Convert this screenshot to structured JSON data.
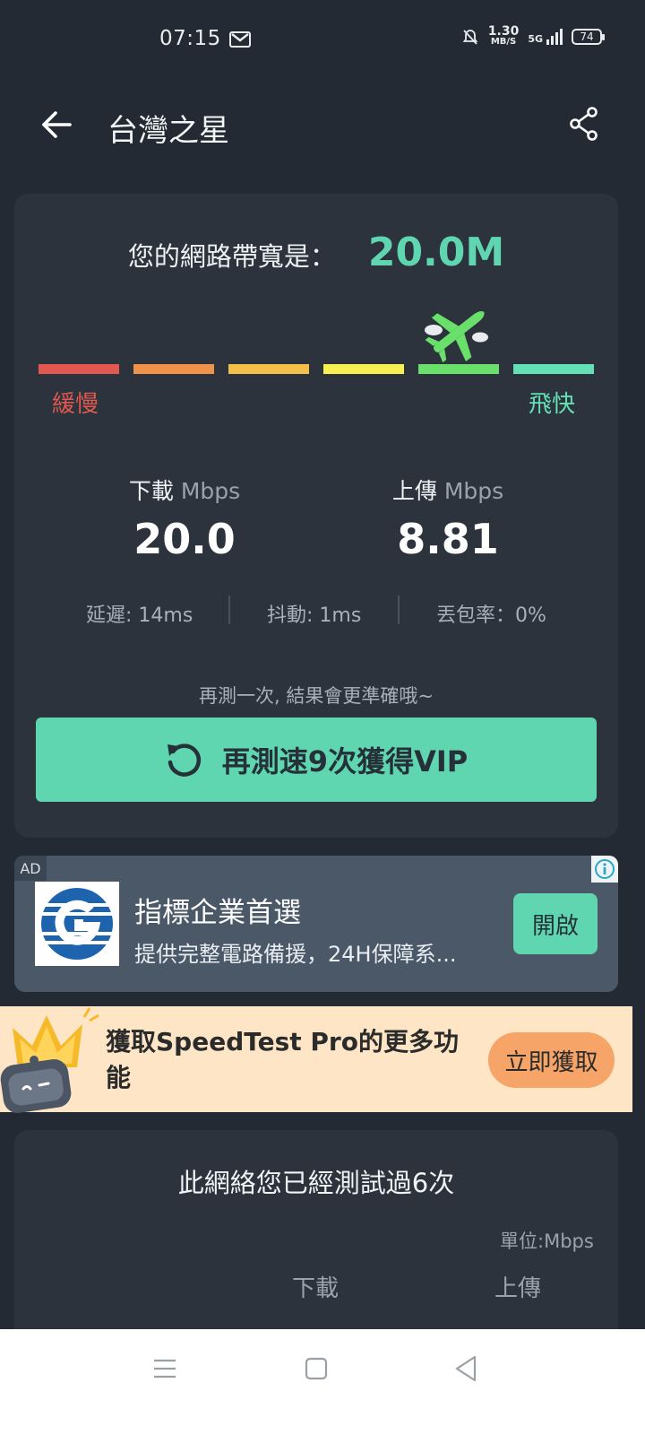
{
  "status_bar": {
    "time": "07:15",
    "net_speed_value": "1.30",
    "net_speed_unit": "MB/S",
    "network_type": "5G",
    "battery": "74",
    "icons": [
      "gmail-icon",
      "mute-bell-icon",
      "signal-icon",
      "battery-icon"
    ]
  },
  "header": {
    "title": "台灣之星",
    "back_icon": "arrow-left-icon",
    "share_icon": "share-icon"
  },
  "result": {
    "bandwidth_label": "您的網路帶寬是：",
    "bandwidth_value": "20.0M",
    "speed_scale": {
      "segment_colors": [
        "#e0584f",
        "#f0924a",
        "#f4c04a",
        "#f7f050",
        "#69e06a",
        "#63e0b4"
      ],
      "active_level": 5,
      "slow_label": "緩慢",
      "fast_label": "飛快",
      "indicator_icon": "airplane-icon"
    },
    "download": {
      "name": "下載",
      "unit": "Mbps",
      "value": "20.0"
    },
    "upload": {
      "name": "上傳",
      "unit": "Mbps",
      "value": "8.81"
    },
    "latency": "延遲: 14ms",
    "jitter": "抖動: 1ms",
    "packet_loss": "丟包率：0%",
    "hint": "再測一次, 結果會更準確哦~",
    "retest_button": "再測速9次獲得VIP",
    "retest_icon": "refresh-icon"
  },
  "ad": {
    "tag": "AD",
    "title": "指標企業首選",
    "description": "提供完整電路備援，24H保障系...",
    "button": "開啟",
    "info_icon": "info-icon",
    "logo_icon": "company-logo-icon"
  },
  "promo": {
    "text": "獲取SpeedTest Pro的更多功能",
    "button": "立即獲取",
    "mascot_icon": "crown-robot-icon"
  },
  "history": {
    "title": "此網絡您已經測試過6次",
    "unit": "單位:Mbps",
    "columns": [
      "下載",
      "上傳"
    ]
  },
  "nav_bar": {
    "icons": [
      "menu-icon",
      "home-square-icon",
      "back-triangle-icon"
    ]
  },
  "colors": {
    "background": "#232a33",
    "card": "#2c333d",
    "accent": "#5fd6b0",
    "promo_bg": "#fde5c6",
    "promo_button": "#f7a468"
  }
}
